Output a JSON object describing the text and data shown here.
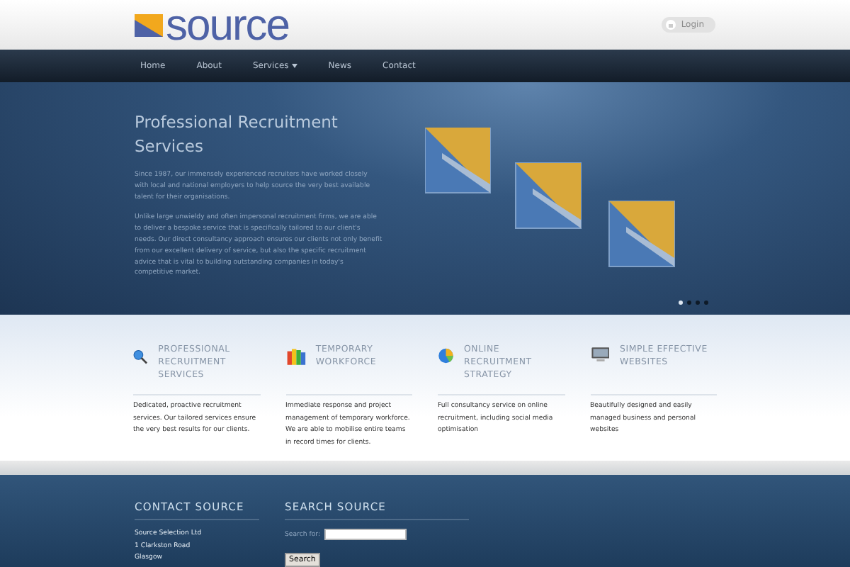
{
  "header": {
    "logo_text": "source",
    "login_button": "Login"
  },
  "nav": {
    "items": [
      {
        "label": "Home",
        "selected": false
      },
      {
        "label": "About",
        "selected": false
      },
      {
        "label": "Services",
        "selected": false,
        "dropdown": true
      },
      {
        "label": "News",
        "selected": false
      },
      {
        "label": "Contact",
        "selected": false
      }
    ]
  },
  "hero": {
    "title": "Professional Recruitment Services",
    "paragraphs": [
      "Since 1987, our immensely experienced recruiters have worked closely with local and national employers to help source the very best available talent for their organisations.",
      "Unlike large unwieldy and often impersonal recruitment firms, we are able to deliver a bespoke service that is specifically tailored to our client's needs. Our direct consultancy approach ensures our clients not only benefit from our excellent delivery of service, but also the specific recruitment advice that is vital to building outstanding companies in today's competitive market."
    ],
    "slides": [
      {
        "selected": true
      },
      {
        "selected": false
      },
      {
        "selected": false
      },
      {
        "selected": false
      }
    ]
  },
  "features": [
    {
      "kind": "search",
      "title": "PROFESSIONAL RECRUITMENT SERVICES",
      "text": "Dedicated, proactive recruitment services. Our tailored services ensure the very best results for our clients."
    },
    {
      "kind": "books",
      "title": "TEMPORARY WORKFORCE",
      "text": "Immediate response and project management of temporary workforce. We are able to mobilise entire teams in record times for clients."
    },
    {
      "kind": "pie",
      "title": "ONLINE RECRUITMENT STRATEGY",
      "text": "Full consultancy service on online recruitment, including social media optimisation"
    },
    {
      "kind": "monitor",
      "title": "SIMPLE EFFECTIVE WEBSITES",
      "text": "Beautifully designed and easily managed business and personal websites"
    }
  ],
  "footer": {
    "contact": {
      "title": "CONTACT SOURCE",
      "lines": [
        "Source Selection Ltd",
        "1 Clarkston Road",
        "Glasgow"
      ]
    },
    "search": {
      "title": "SEARCH SOURCE",
      "label": "Search for:",
      "button": "Search"
    }
  }
}
